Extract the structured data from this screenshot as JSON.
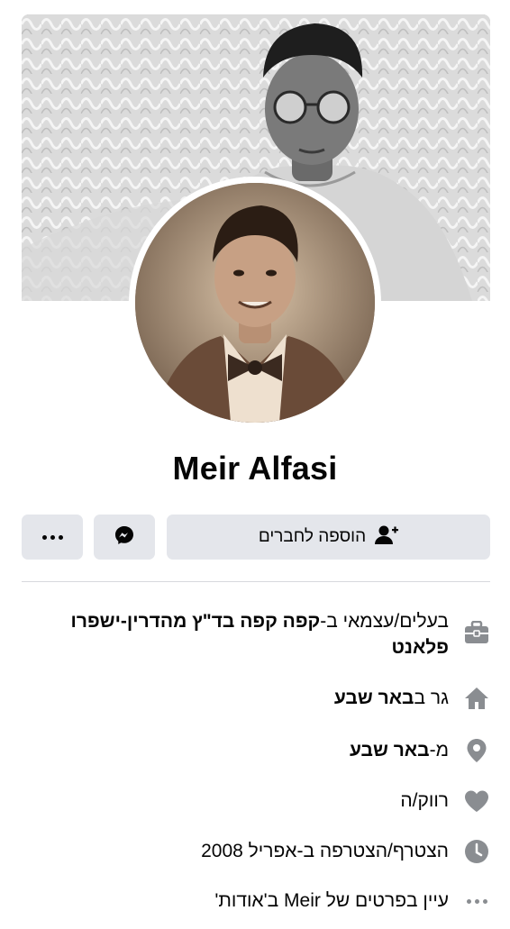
{
  "profile": {
    "name": "Meir Alfasi"
  },
  "actions": {
    "add_friend_label": "הוספה לחברים",
    "messenger_icon": "messenger-icon",
    "more_icon": "more-dots-icon"
  },
  "intro": {
    "work_prefix": "בעלים/עצמאי ב-",
    "work_place": "קפה קפה בד\"ץ מהדרין-ישפרו פלאנט",
    "lives_prefix": "גר ב",
    "lives_place": "באר שבע",
    "from_prefix": "מ-",
    "from_place": "באר שבע",
    "relationship": "רווק/ה",
    "joined": "הצטרף/הצטרפה ב-אפריל 2008",
    "about_link": "עיין בפרטים של Meir ב'אודות'"
  },
  "colors": {
    "button_bg": "#e4e6eb",
    "icon_grey": "#8a8d91",
    "text": "#050505"
  }
}
